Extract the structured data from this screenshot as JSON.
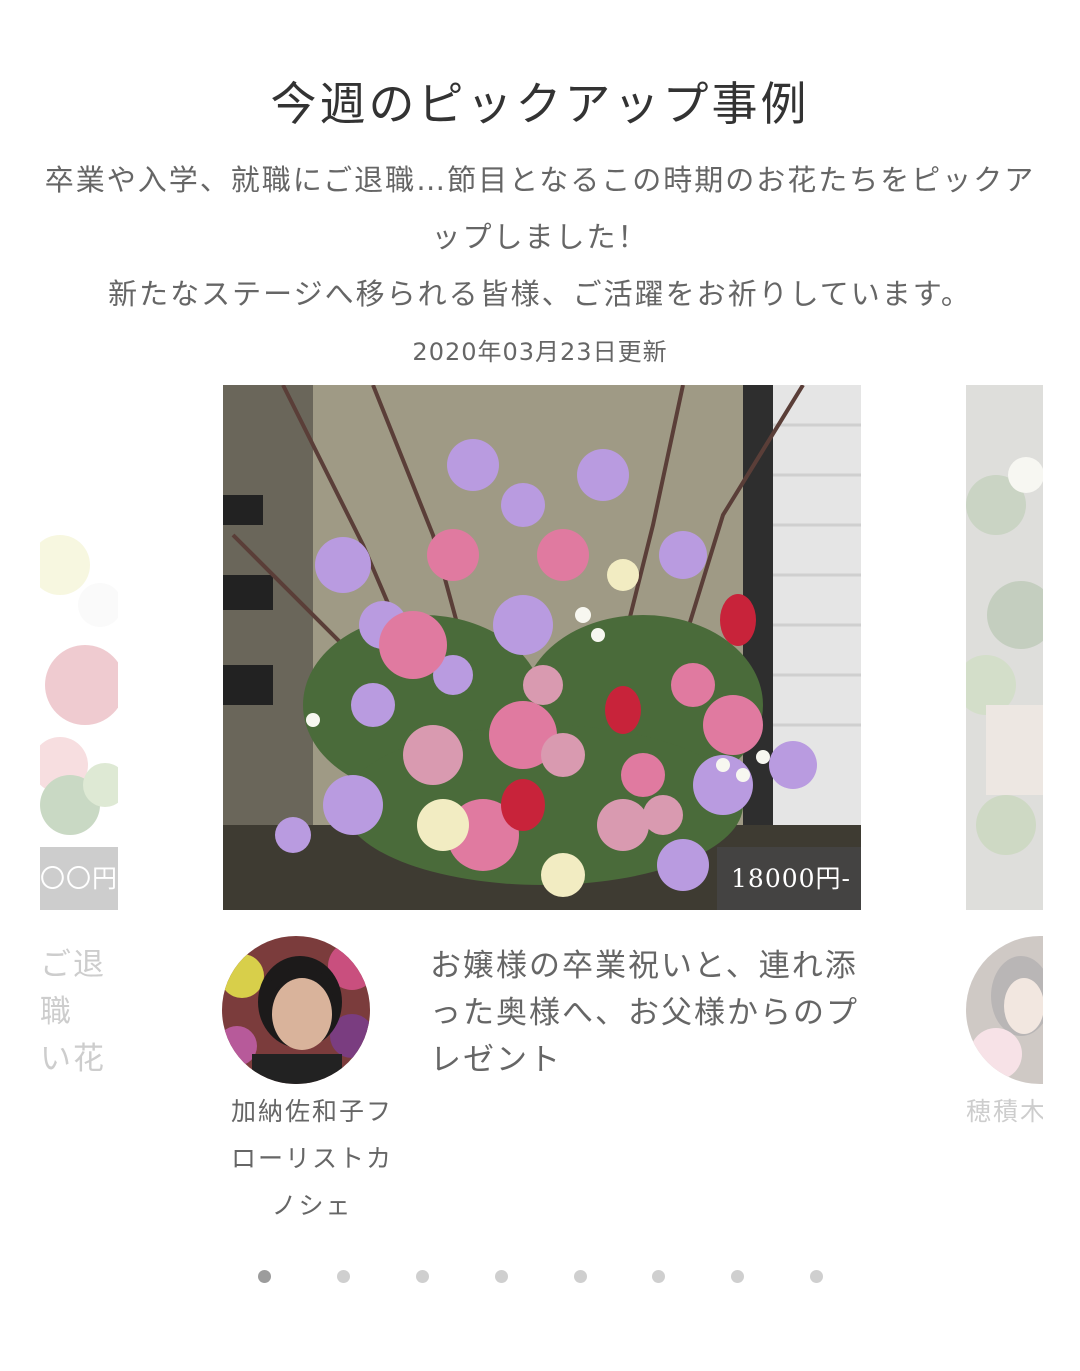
{
  "section": {
    "title": "今週のピックアップ事例",
    "description_line1": "卒業や入学、就職にご退職…節目となるこの時期のお花たちをピックアップしました！",
    "description_line2": "新たなステージへ移られる皆様、ご活躍をお祈りしています。",
    "updated": "2020年03月23日更新"
  },
  "carousel": {
    "prev": {
      "price": "〇〇円-",
      "caption": "ご退職\nい花"
    },
    "current": {
      "price": "18000円-",
      "caption": "お嬢様の卒業祝いと、連れ添った奥様へ、お父様からのプレゼント",
      "florist": "加納佐和子フローリストカノシェ"
    },
    "next": {
      "florist": "穂積木"
    },
    "dots": [
      {
        "active": true
      },
      {
        "active": false
      },
      {
        "active": false
      },
      {
        "active": false
      },
      {
        "active": false
      },
      {
        "active": false
      },
      {
        "active": false
      },
      {
        "active": false
      }
    ]
  },
  "colors": {
    "title": "#333333",
    "text": "#666666",
    "price_overlay": "#464646",
    "dot_inactive": "#cfcfcf",
    "dot_active": "#9c9c9c"
  }
}
